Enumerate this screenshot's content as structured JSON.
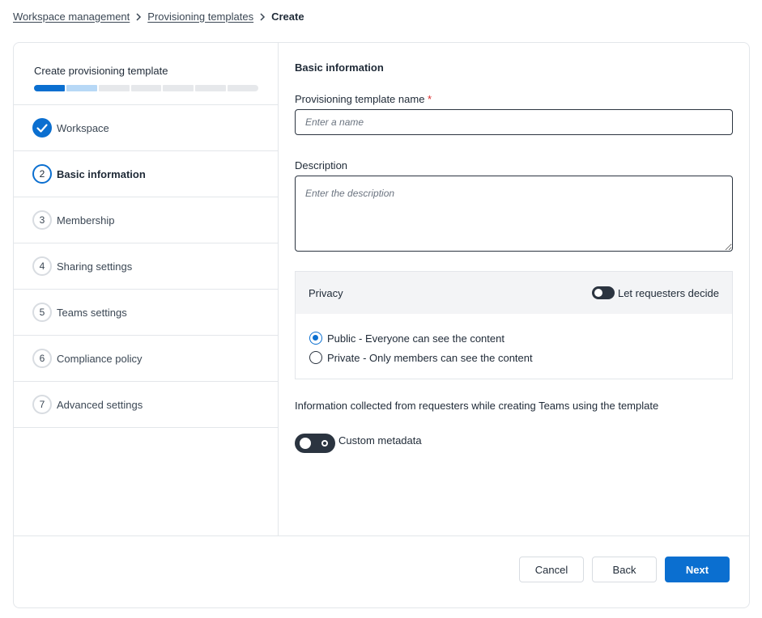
{
  "breadcrumb": {
    "items": [
      "Workspace management",
      "Provisioning templates"
    ],
    "current": "Create"
  },
  "wizard": {
    "title": "Create provisioning template",
    "progress": {
      "total_steps": 7,
      "completed": 1,
      "current": 2
    },
    "steps": [
      {
        "number": "1",
        "label": "Workspace",
        "state": "completed"
      },
      {
        "number": "2",
        "label": "Basic information",
        "state": "current"
      },
      {
        "number": "3",
        "label": "Membership",
        "state": "pending"
      },
      {
        "number": "4",
        "label": "Sharing settings",
        "state": "pending"
      },
      {
        "number": "5",
        "label": "Teams settings",
        "state": "pending"
      },
      {
        "number": "6",
        "label": "Compliance policy",
        "state": "pending"
      },
      {
        "number": "7",
        "label": "Advanced settings",
        "state": "pending"
      }
    ]
  },
  "form": {
    "section_title": "Basic information",
    "name": {
      "label": "Provisioning template name",
      "required_mark": "*",
      "placeholder": "Enter a name",
      "value": ""
    },
    "description": {
      "label": "Description",
      "placeholder": "Enter the description",
      "value": ""
    },
    "privacy": {
      "title": "Privacy",
      "toggle_label": "Let requesters decide",
      "toggle_on": false,
      "options": [
        {
          "label": "Public - Everyone can see the content",
          "selected": true
        },
        {
          "label": "Private - Only members can see the content",
          "selected": false
        }
      ]
    },
    "info_text": "Information collected from requesters while creating Teams using the template",
    "custom_metadata": {
      "label": "Custom metadata",
      "on": false
    }
  },
  "footer": {
    "cancel_label": "Cancel",
    "back_label": "Back",
    "next_label": "Next"
  },
  "colors": {
    "accent": "#0b6fd0",
    "accent_light": "#b7d8f6",
    "required": "#d92c2c",
    "toggle_dark": "#2b3440"
  }
}
